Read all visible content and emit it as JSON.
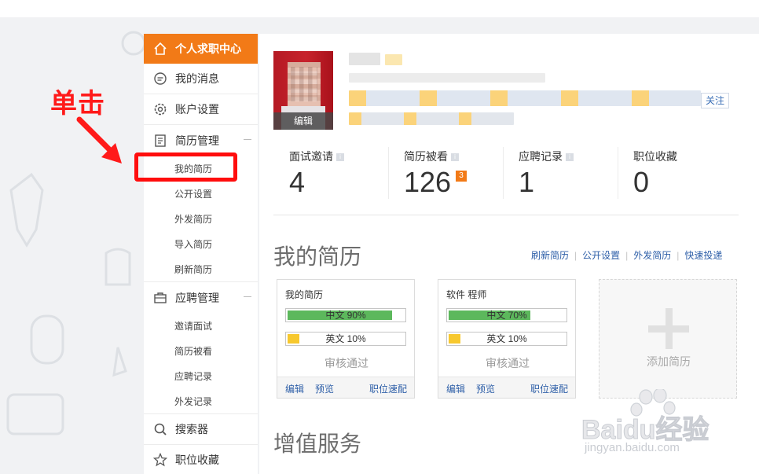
{
  "sidebar": {
    "header": {
      "label": "个人求职中心"
    },
    "items": [
      {
        "label": "我的消息"
      },
      {
        "label": "账户设置"
      },
      {
        "label": "简历管理"
      },
      {
        "label": "应聘管理"
      },
      {
        "label": "搜索器"
      },
      {
        "label": "职位收藏"
      }
    ],
    "resume_sub": [
      "我的简历",
      "公开设置",
      "外发简历",
      "导入简历",
      "刷新简历"
    ],
    "apply_sub": [
      "邀请面试",
      "简历被看",
      "应聘记录",
      "外发记录"
    ]
  },
  "annotation": {
    "text": "单击",
    "color": "#ff1a1a"
  },
  "profile": {
    "avatar_edit": "编辑",
    "follow": "关注"
  },
  "stats": [
    {
      "label": "面试邀请",
      "value": "4"
    },
    {
      "label": "简历被看",
      "value": "126",
      "badge": "3"
    },
    {
      "label": "应聘记录",
      "value": "1"
    },
    {
      "label": "职位收藏",
      "value": "0"
    }
  ],
  "resume_section": {
    "title": "我的简历",
    "links": [
      "刷新简历",
      "公开设置",
      "外发简历",
      "快速投递"
    ],
    "cards": [
      {
        "name": "我的简历",
        "bar1": {
          "text": "中文 90%",
          "fraction": 0.9
        },
        "bar2": {
          "text": "英文 10%",
          "fraction": 0.1
        },
        "status": "审核通过",
        "actions": [
          "编辑",
          "预览",
          "职位速配"
        ]
      },
      {
        "name": "软件 程师",
        "bar1": {
          "text": "中文 70%",
          "fraction": 0.7
        },
        "bar2": {
          "text": "英文 10%",
          "fraction": 0.1
        },
        "status": "审核通过",
        "actions": [
          "编辑",
          "预览",
          "职位速配"
        ]
      }
    ],
    "add_label": "添加简历"
  },
  "service_section": {
    "title": "增值服务"
  },
  "watermark": {
    "brand": "Baidu经验",
    "url": "jingyan.baidu.com"
  },
  "colors": {
    "accent": "#f27a17",
    "link": "#2e5fa8",
    "progress_green": "#5cb85c",
    "progress_yellow": "#f7c82e"
  }
}
